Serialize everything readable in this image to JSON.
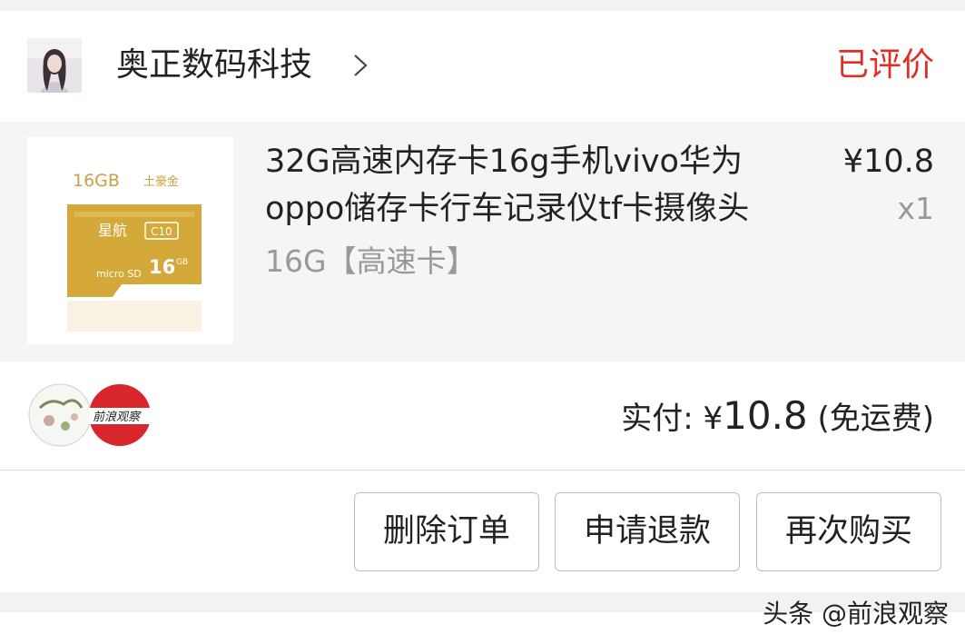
{
  "shop": {
    "name": "奥正数码科技",
    "avatar_icon": "shop-avatar-photo",
    "chevron_icon": "chevron-right-icon",
    "order_status": "已评价"
  },
  "item": {
    "title": "32G高速内存卡16g手机vivo华为oppo储存卡行车记录仪tf卡摄像头",
    "sku": "16G【高速卡】",
    "price": "¥10.8",
    "quantity": "x1",
    "thumbnail_text": {
      "capacity_label": "16GB",
      "brand_label": "土豪金",
      "card_brand": "星航",
      "speed_class": "C10",
      "card_capacity": "16",
      "card_unit": "GB"
    }
  },
  "payment": {
    "label": "实付: ",
    "currency": "¥",
    "amount": "10.8",
    "shipping_note": " (免运费)",
    "stamp_text": "前浪观察"
  },
  "actions": {
    "delete_label": "删除订单",
    "refund_label": "申请退款",
    "rebuy_label": "再次购买"
  },
  "watermark": "头条 @前浪观察",
  "colors": {
    "status_red": "#e02e24",
    "card_gold": "#d4a93a",
    "stamp_red": "#d9252c"
  }
}
